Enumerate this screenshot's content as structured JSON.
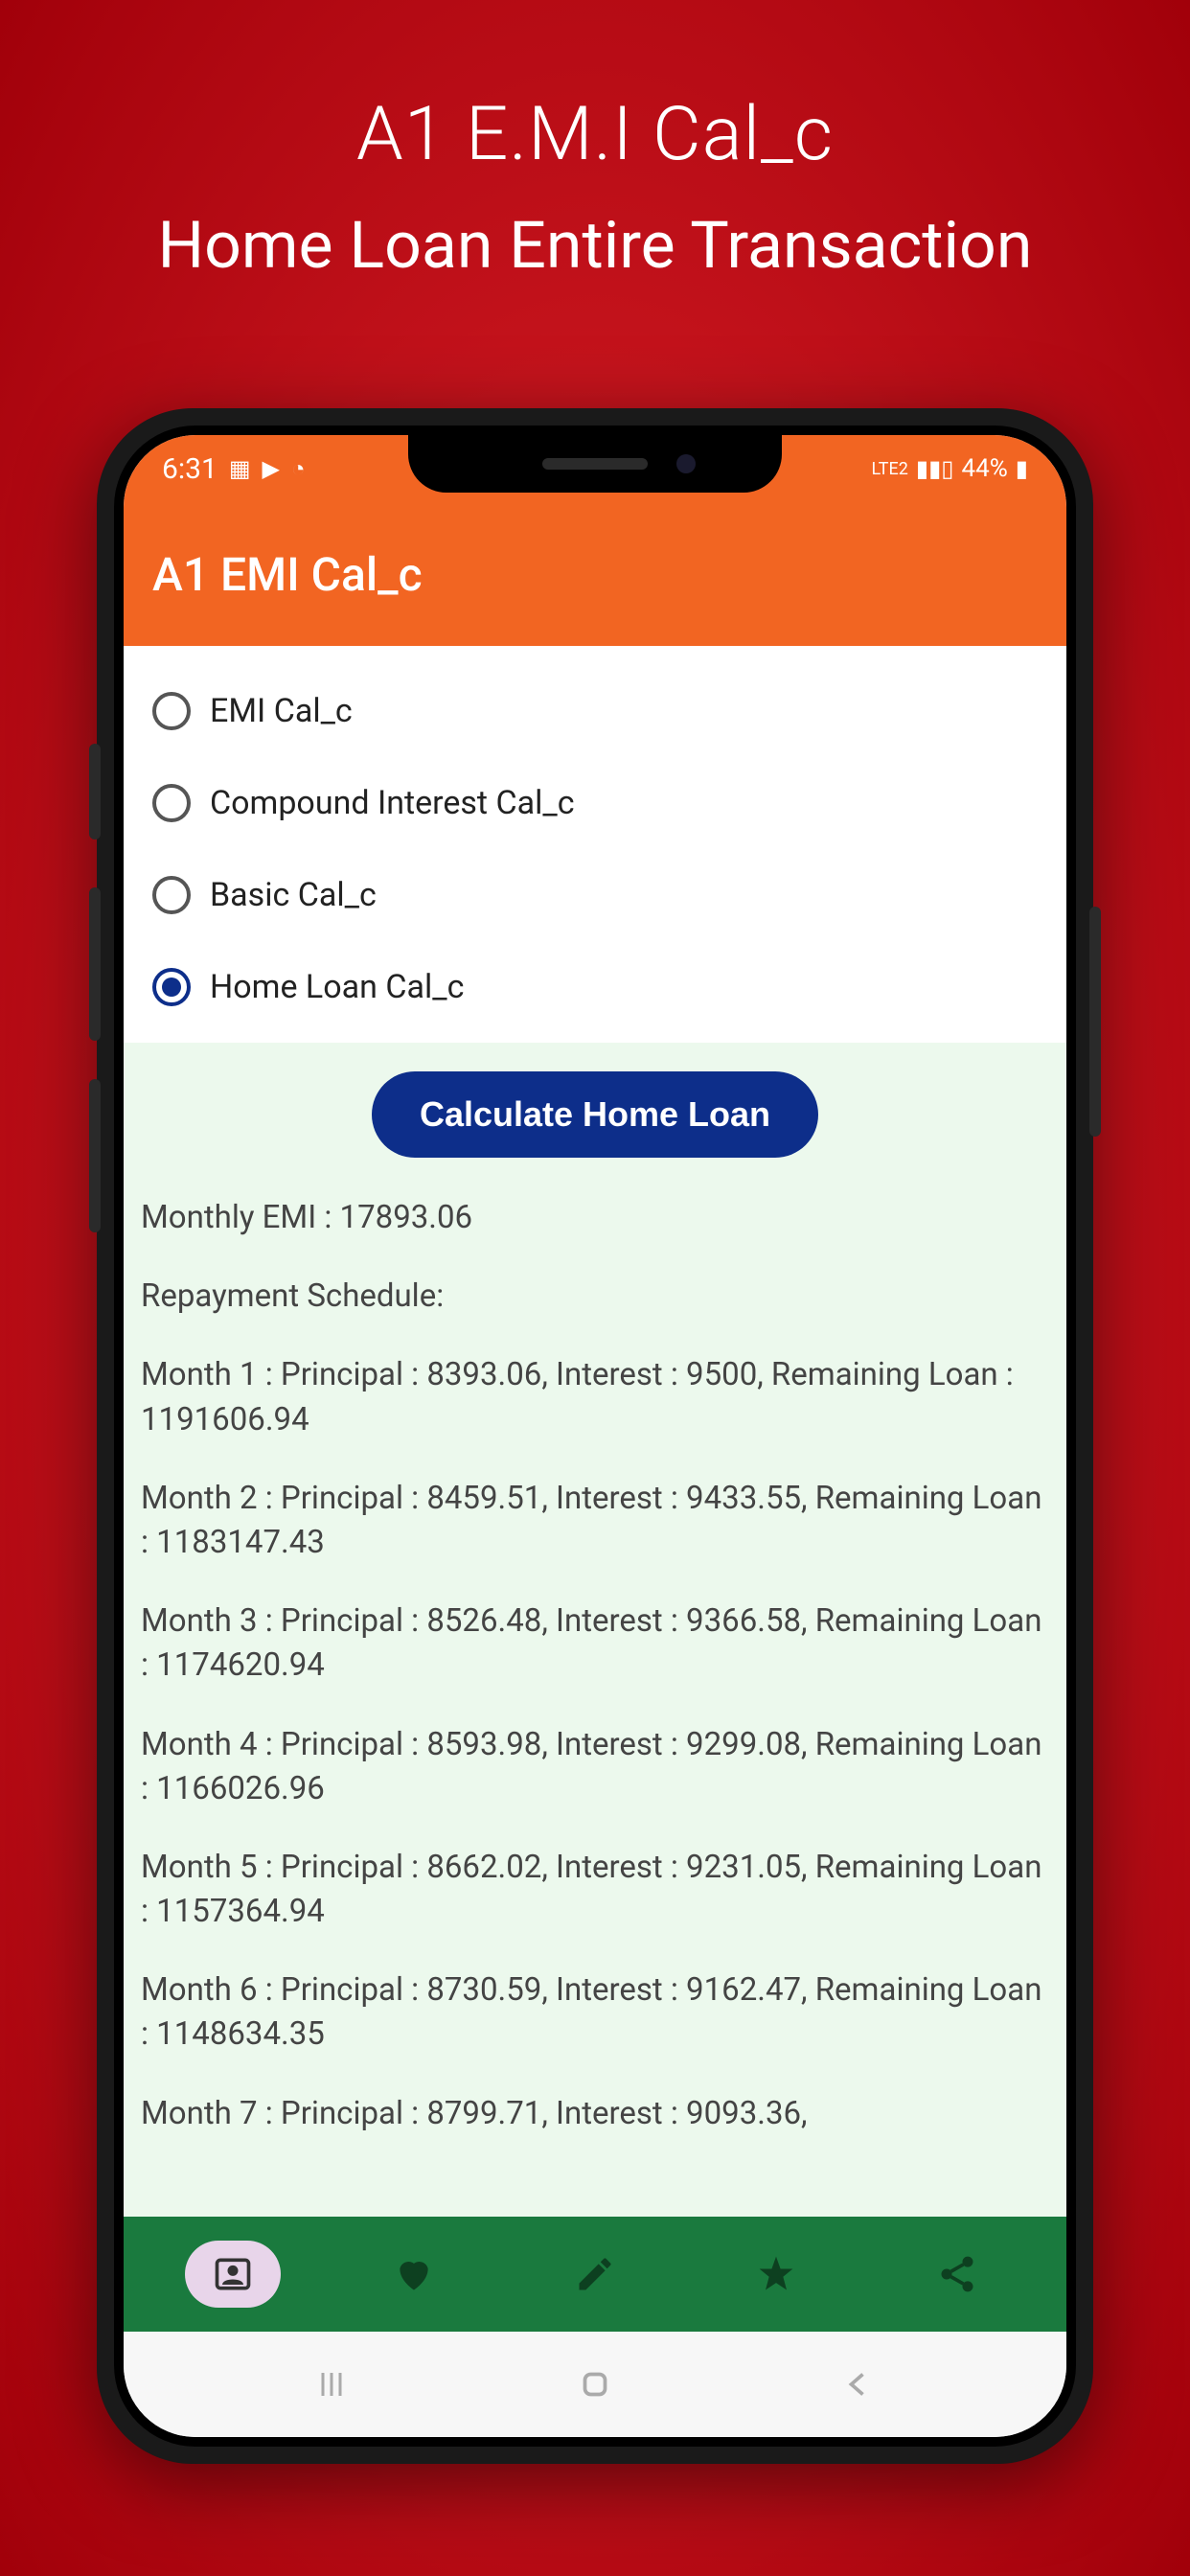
{
  "promo": {
    "title": "A1 E.M.I Cal_c",
    "subtitle": "Home Loan Entire Transaction"
  },
  "status_bar": {
    "time": "6:31",
    "network_label": "LTE2",
    "battery": "44%"
  },
  "header": {
    "title": "A1 EMI Cal_c"
  },
  "radio_options": [
    {
      "label": "EMI Cal_c",
      "selected": false
    },
    {
      "label": "Compound Interest Cal_c",
      "selected": false
    },
    {
      "label": "Basic Cal_c",
      "selected": false
    },
    {
      "label": "Home Loan Cal_c",
      "selected": true
    }
  ],
  "button": {
    "calculate": "Calculate Home Loan"
  },
  "results": {
    "emi_label": "Monthly EMI : 17893.06",
    "schedule_header": "Repayment Schedule:",
    "months": [
      "Month 1 : Principal : 8393.06, Interest : 9500, Remaining Loan : 1191606.94",
      "Month 2 : Principal : 8459.51, Interest : 9433.55, Remaining Loan : 1183147.43",
      "Month 3 : Principal : 8526.48, Interest : 9366.58, Remaining Loan : 1174620.94",
      "Month 4 : Principal : 8593.98, Interest : 9299.08, Remaining Loan : 1166026.96",
      "Month 5 : Principal : 8662.02, Interest : 9231.05, Remaining Loan : 1157364.94",
      "Month 6 : Principal : 8730.59, Interest : 9162.47, Remaining Loan : 1148634.35",
      "Month 7 : Principal : 8799.71, Interest : 9093.36,"
    ]
  }
}
